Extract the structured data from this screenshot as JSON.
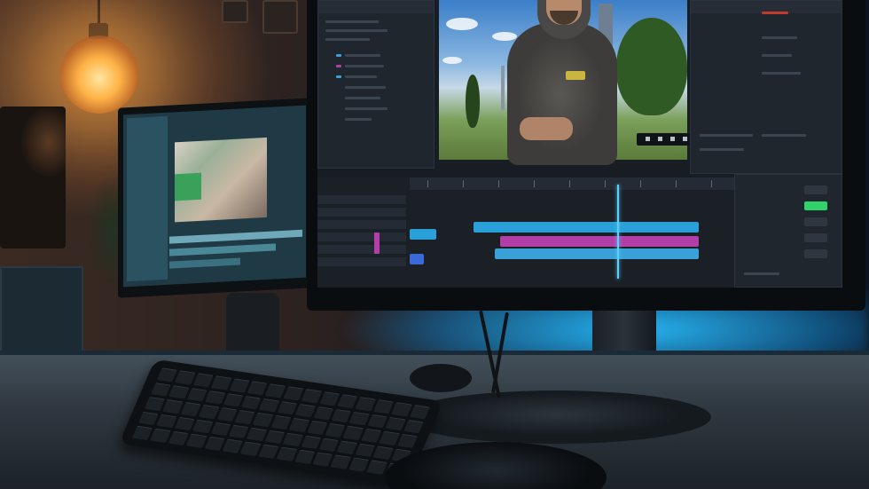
{
  "scene": {
    "accent_blue": "#2ac0ff",
    "lamp_color": "#ffb347",
    "clip_colors": [
      "#2a9fd8",
      "#b23fa8",
      "#3aa0d8",
      "#8a3ad0",
      "#5a7ad8"
    ],
    "icons": [
      "pendant-lamp-icon",
      "keyboard-icon",
      "mouse-icon",
      "monitor-icon",
      "play-icon"
    ]
  }
}
